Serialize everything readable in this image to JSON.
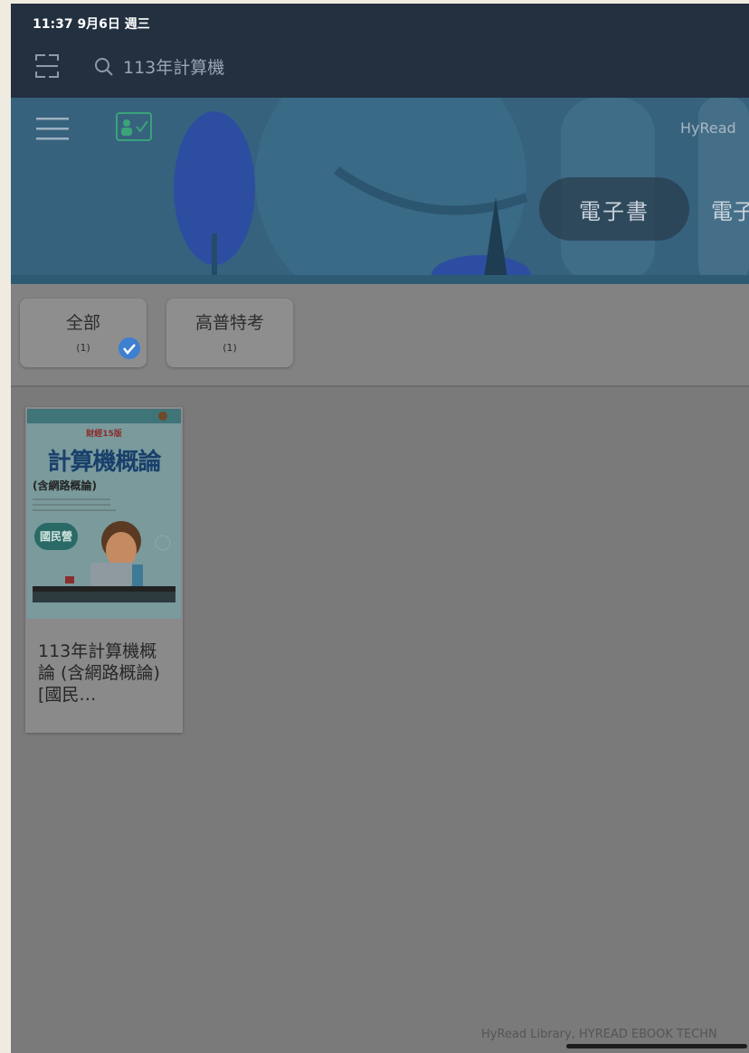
{
  "status_bar": {
    "time": "11:37  9月6日 週三"
  },
  "search": {
    "query": "113年計算機"
  },
  "banner": {
    "brand": "HyRead",
    "tabs": [
      {
        "label": "電子書"
      },
      {
        "label": "電子"
      }
    ]
  },
  "filters": [
    {
      "label": "全部",
      "count": "(1)",
      "selected": true
    },
    {
      "label": "高普特考",
      "count": "(1)",
      "selected": false
    }
  ],
  "books": [
    {
      "title": "113年計算機概論 (含網路概論)[國民…",
      "cover": {
        "badge": "財經15版",
        "title": "計算機概論",
        "subtitle": "(含網路概論)",
        "tag": "國民營"
      }
    }
  ],
  "footer": {
    "text": "HyRead Library, HYREAD EBOOK TECHN"
  },
  "colors": {
    "topbar": "#233040",
    "banner": "#37627e",
    "check": "#3d7fd0"
  }
}
